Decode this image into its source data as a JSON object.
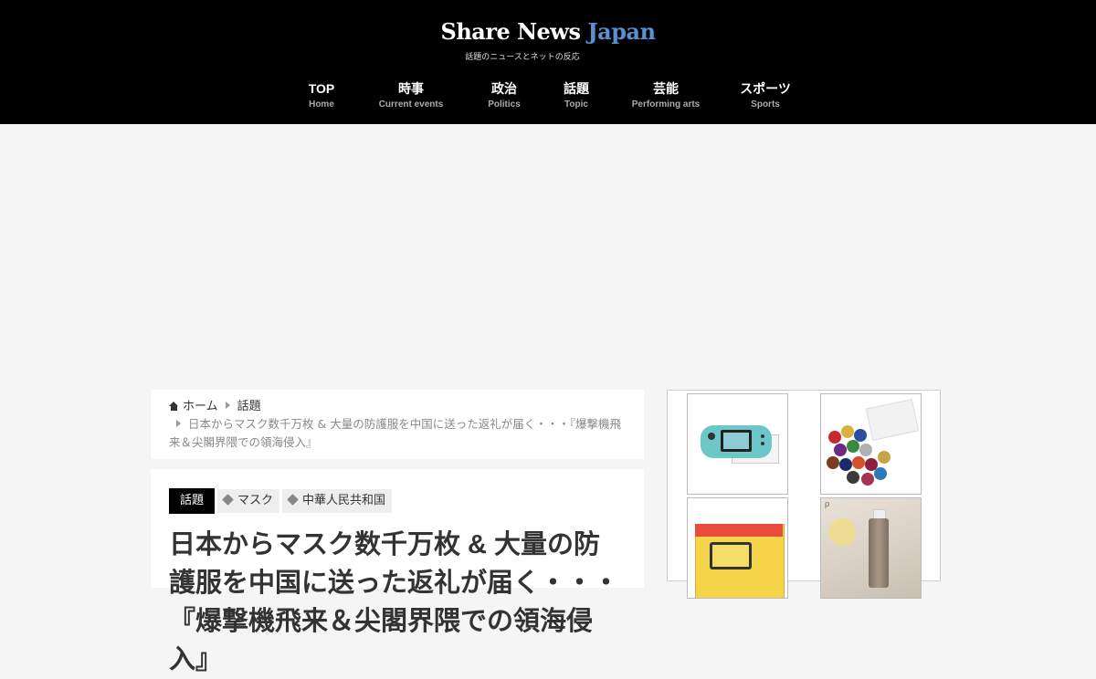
{
  "site": {
    "logo_white": "Share News ",
    "logo_accent": "Japan",
    "tagline": "話題のニュースとネットの反応",
    "accent_color": "#5a8fd0"
  },
  "nav": [
    {
      "label": "TOP",
      "sub": "Home"
    },
    {
      "label": "時事",
      "sub": "Current events"
    },
    {
      "label": "政治",
      "sub": "Politics"
    },
    {
      "label": "話題",
      "sub": "Topic"
    },
    {
      "label": "芸能",
      "sub": "Performing arts"
    },
    {
      "label": "スポーツ",
      "sub": "Sports"
    }
  ],
  "breadcrumb": {
    "home_icon": "home-icon",
    "home": "ホーム",
    "category": "話題",
    "current": "日本からマスク数千万枚 & 大量の防護服を中国に送った返礼が届く・・・『爆撃機飛来＆尖閣界隈での領海侵入』"
  },
  "article": {
    "category": "話題",
    "tag_icon": "tag-icon",
    "tags": [
      "マスク",
      "中華人民共和国"
    ],
    "title": "日本からマスク数千万枚 & 大量の防護服を中国に送った返礼が届く・・・『爆撃機飛来＆尖閣界隈での領海侵入』"
  },
  "sidebar": {
    "products": [
      {
        "name": "switch-lite-turquoise"
      },
      {
        "name": "chocolate-assortment"
      },
      {
        "name": "switch-lite-yellow"
      },
      {
        "name": "cosmetic-bottle"
      }
    ]
  }
}
